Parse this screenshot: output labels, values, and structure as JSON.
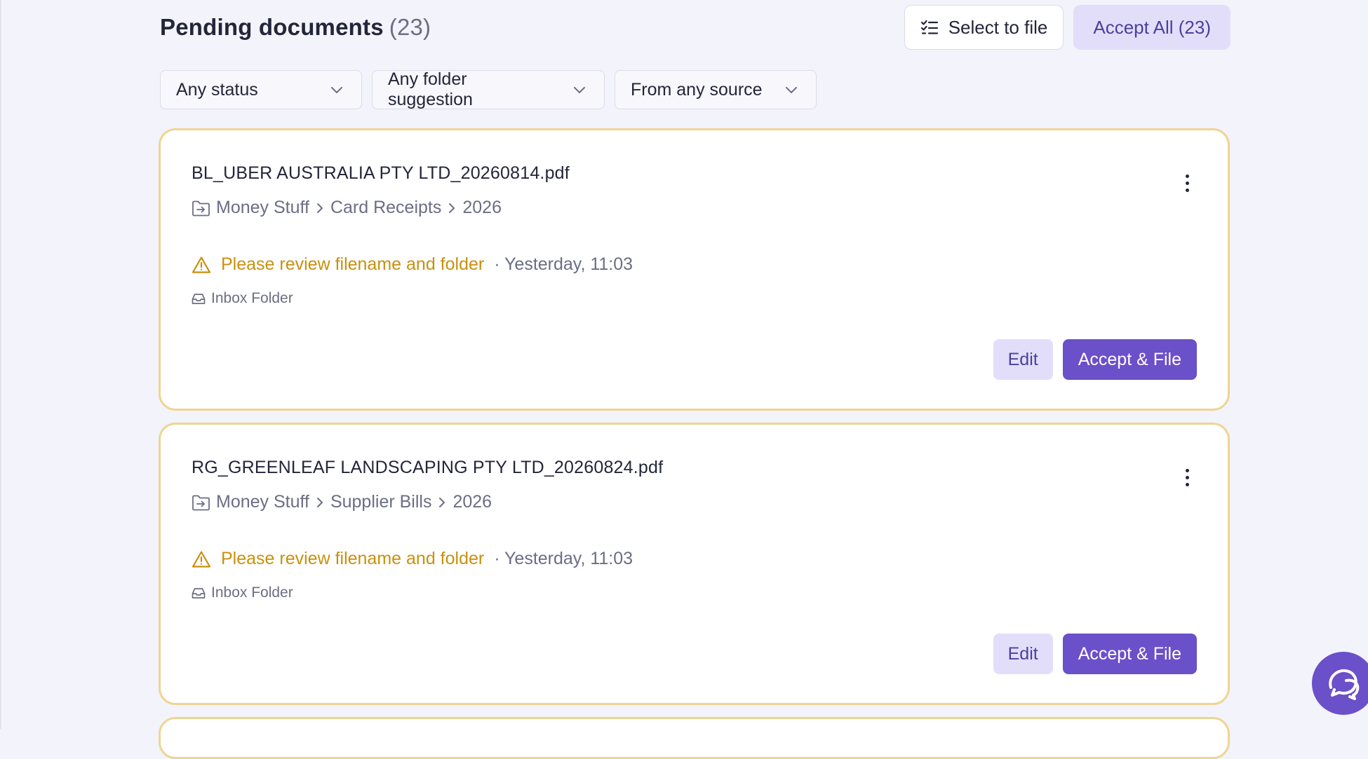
{
  "header": {
    "title": "Pending documents",
    "count": "(23)",
    "select_label": "Select to file",
    "accept_all_label": "Accept All (23)"
  },
  "filters": [
    {
      "label": "Any status"
    },
    {
      "label": "Any folder suggestion"
    },
    {
      "label": "From any source"
    }
  ],
  "documents": [
    {
      "filename": "BL_UBER AUSTRALIA PTY LTD_20260814.pdf",
      "path": [
        "Money Stuff",
        "Card Receipts",
        "2026"
      ],
      "status": "Please review filename and folder",
      "time": "· Yesterday, 11:03",
      "source": "Inbox Folder",
      "edit_label": "Edit",
      "accept_label": "Accept & File"
    },
    {
      "filename": "RG_GREENLEAF LANDSCAPING PTY LTD_20260824.pdf",
      "path": [
        "Money Stuff",
        "Supplier Bills",
        "2026"
      ],
      "status": "Please review filename and folder",
      "time": "· Yesterday, 11:03",
      "source": "Inbox Folder",
      "edit_label": "Edit",
      "accept_label": "Accept & File"
    }
  ],
  "icons": {
    "select": "checklist-icon",
    "filter_chevron": "chevron-down-icon",
    "path_folder": "folder-move-icon",
    "path_separator": "chevron-right-icon",
    "more": "more-vertical-icon",
    "status": "warning-icon",
    "source": "inbox-icon",
    "chat": "chat-icon"
  },
  "colors": {
    "accent": "#6a50c9",
    "accent_soft": "#e2defa",
    "warning": "#c9900e",
    "card_border": "#efd592",
    "background": "#f3f3fb"
  }
}
